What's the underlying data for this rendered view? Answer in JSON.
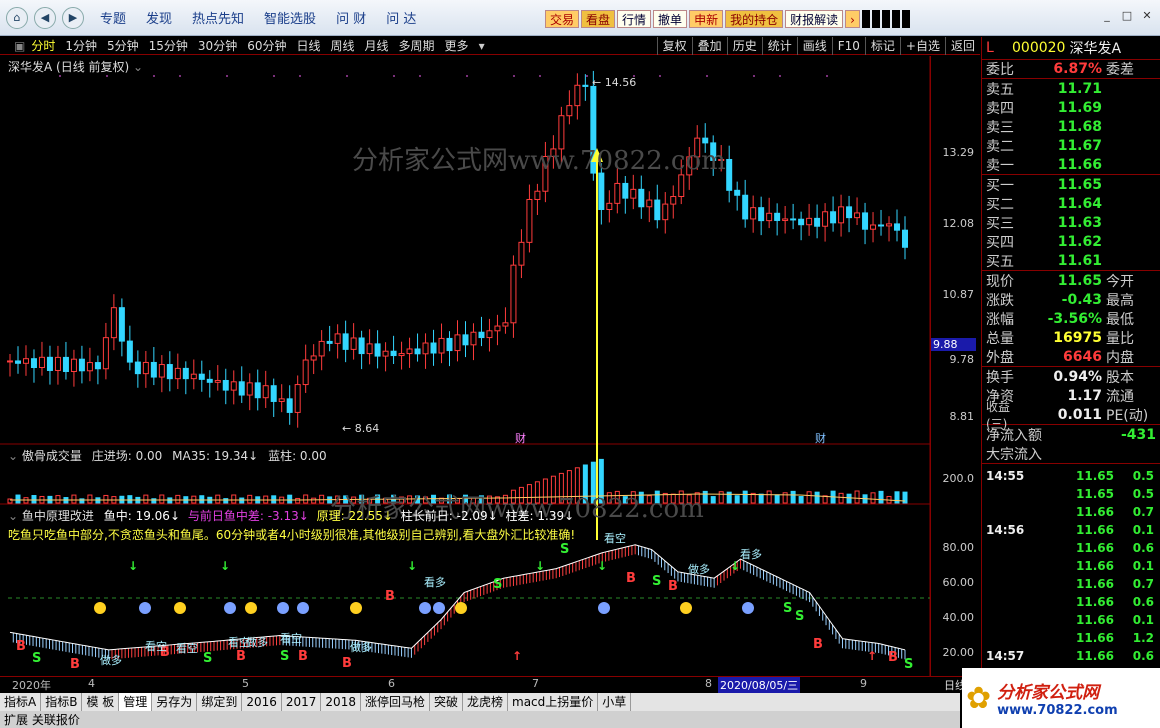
{
  "topbar": {
    "menu": [
      "专题",
      "发现",
      "热点先知",
      "智能选股",
      "问 财",
      "问 达"
    ],
    "buttons": [
      "交易",
      "看盘",
      "行情",
      "撤单",
      "申新",
      "我的持仓",
      "财报解读"
    ]
  },
  "periodbar": {
    "periods": [
      "分时",
      "1分钟",
      "5分钟",
      "15分钟",
      "30分钟",
      "60分钟",
      "日线",
      "周线",
      "月线",
      "多周期",
      "更多"
    ],
    "active": "分时",
    "tools": [
      "复权",
      "叠加",
      "历史",
      "统计",
      "画线",
      "F10",
      "标记",
      "+自选",
      "返回"
    ]
  },
  "main_chart": {
    "title": "深华发A (日线 前复权)",
    "high_label": "14.56",
    "low_label": "8.64",
    "y_ticks": [
      "13.29",
      "12.08",
      "10.87",
      "9.78",
      "8.81"
    ],
    "price_box": "9.88",
    "markers": [
      "财",
      "财"
    ],
    "watermark": "分析家公式网www.70822.com"
  },
  "volume_panel": {
    "title": "傲骨成交量",
    "fields": [
      "庄进场: 0.00",
      "MA35: 19.34↓",
      "蓝柱: 0.00"
    ],
    "y_tick": "200.0"
  },
  "indicator_panel": {
    "title": "鱼中原理改进",
    "fields": [
      "鱼中: 19.06↓",
      "与前日鱼中差: -3.13↓",
      "原理: 22.55↓",
      "柱长前日: -2.09↓",
      "柱差: 1.39↓"
    ],
    "note": "吃鱼只吃鱼中部分,不贪恋鱼头和鱼尾。60分钟或者4小时级别很准,其他级别自己辨别,看大盘外汇比较准确!",
    "y_ticks": [
      "80.00",
      "60.00",
      "40.00",
      "20.00"
    ],
    "labels": [
      "看空",
      "做多",
      "看空",
      "做多",
      "看空",
      "做多",
      "看多",
      "看空",
      "做多",
      "看多",
      "看空"
    ],
    "watermark": "分析家公式网www.70822.com"
  },
  "date_axis": {
    "labels": [
      "2020年",
      "4",
      "5",
      "6",
      "7",
      "8",
      "9"
    ],
    "cursor_date": "2020/08/05/三",
    "right_label": "日线"
  },
  "quote": {
    "code": "000020",
    "name": "深华发A",
    "tag": "L",
    "weibi": {
      "label": "委比",
      "value": "6.87%",
      "right": "委差"
    },
    "asks": [
      {
        "label": "卖五",
        "value": "11.71"
      },
      {
        "label": "卖四",
        "value": "11.69"
      },
      {
        "label": "卖三",
        "value": "11.68"
      },
      {
        "label": "卖二",
        "value": "11.67"
      },
      {
        "label": "卖一",
        "value": "11.66"
      }
    ],
    "bids": [
      {
        "label": "买一",
        "value": "11.65"
      },
      {
        "label": "买二",
        "value": "11.64"
      },
      {
        "label": "买三",
        "value": "11.63"
      },
      {
        "label": "买四",
        "value": "11.62"
      },
      {
        "label": "买五",
        "value": "11.61"
      }
    ],
    "stats": [
      {
        "label": "现价",
        "value": "11.65",
        "right": "今开",
        "color": "green"
      },
      {
        "label": "涨跌",
        "value": "-0.43",
        "right": "最高",
        "color": "green"
      },
      {
        "label": "涨幅",
        "value": "-3.56%",
        "right": "最低",
        "color": "green"
      },
      {
        "label": "总量",
        "value": "16975",
        "right": "量比",
        "color": "yellow"
      },
      {
        "label": "外盘",
        "value": "6646",
        "right": "内盘",
        "color": "red"
      }
    ],
    "stats2": [
      {
        "label": "换手",
        "value": "0.94%",
        "right": "股本"
      },
      {
        "label": "净资",
        "value": "1.17",
        "right": "流通"
      },
      {
        "label": "收益(三)",
        "value": "0.011",
        "right": "PE(动)"
      }
    ],
    "netflow": {
      "label": "净流入额",
      "value": "-431"
    },
    "bigflow": {
      "label": "大宗流入"
    },
    "ticks": [
      {
        "time": "14:55",
        "price": "11.65",
        "vol": "0.5"
      },
      {
        "time": "",
        "price": "11.65",
        "vol": "0.5"
      },
      {
        "time": "",
        "price": "11.66",
        "vol": "0.7"
      },
      {
        "time": "14:56",
        "price": "11.66",
        "vol": "0.1"
      },
      {
        "time": "",
        "price": "11.66",
        "vol": "0.6"
      },
      {
        "time": "",
        "price": "11.66",
        "vol": "0.1"
      },
      {
        "time": "",
        "price": "11.66",
        "vol": "0.7"
      },
      {
        "time": "",
        "price": "11.66",
        "vol": "0.6"
      },
      {
        "time": "",
        "price": "11.66",
        "vol": "0.1"
      },
      {
        "time": "",
        "price": "11.66",
        "vol": "1.2"
      },
      {
        "time": "14:57",
        "price": "11.66",
        "vol": "0.6"
      }
    ]
  },
  "tabs": [
    "指标A",
    "指标B",
    "模 板",
    "管理",
    "另存为",
    "绑定到",
    "2016",
    "2017",
    "2018",
    "涨停回马枪",
    "突破",
    "龙虎榜",
    "macd上拐量价",
    "小草"
  ],
  "tabs_row2": "扩展    关联报价",
  "logo": {
    "text": "分析家公式网",
    "url": "www.70822.com"
  }
}
